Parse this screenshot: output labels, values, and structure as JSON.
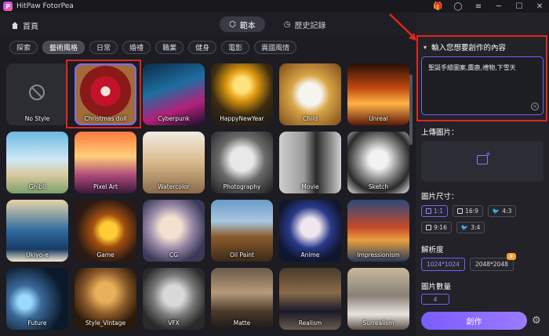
{
  "app": {
    "title": "HitPaw FotorPea"
  },
  "window_controls": [
    "minimize",
    "maximize",
    "close"
  ],
  "header": {
    "home_label": "首頁",
    "tabs": [
      {
        "label": "範本",
        "icon": "cube-icon",
        "active": true
      },
      {
        "label": "歷史記錄",
        "icon": "history-icon",
        "active": false
      }
    ]
  },
  "style_chips": [
    {
      "label": "探索",
      "active": false
    },
    {
      "label": "藝術風格",
      "active": true
    },
    {
      "label": "日常",
      "active": false
    },
    {
      "label": "婚禮",
      "active": false
    },
    {
      "label": "職業",
      "active": false
    },
    {
      "label": "健身",
      "active": false
    },
    {
      "label": "電影",
      "active": false
    },
    {
      "label": "異國風情",
      "active": false
    }
  ],
  "styles": [
    {
      "label": "No Style",
      "bg": "#2c2c33"
    },
    {
      "label": "Christmas doll",
      "bg": "radial-gradient(circle at 50% 45%, #f3e4d6 0 10%, #c4122b 11% 32%, #8a1a1a 33% 55%, #a26b3a 56%)"
    },
    {
      "label": "Cyberpunk",
      "bg": "linear-gradient(160deg,#0b2a4a,#1e6ea0 40%,#b3207a 70%,#1a0f2a)"
    },
    {
      "label": "HappyNewYear",
      "bg": "radial-gradient(circle at 50% 35%, #ffe27a 0 15%, #e09a10 30%, #3a2a10 60%, #1a1a1a)"
    },
    {
      "label": "Child",
      "bg": "radial-gradient(circle at 50% 50%, #f5f5f0 0 25%, #d8a445 45%, #7a4a1a)"
    },
    {
      "label": "Unreal",
      "bg": "linear-gradient(180deg,#2a0e06,#c14a10 40%,#ffb347 65%,#5a1a08)"
    },
    {
      "label": "Ghibli",
      "bg": "linear-gradient(180deg,#6cb9e2,#cfe8f5 45%,#d9c9a0 70%,#7aa06a)"
    },
    {
      "label": "Pixel Art",
      "bg": "linear-gradient(180deg,#ff7a3c,#ffd07a 40%,#b04a7a 70%,#3a1a3a)"
    },
    {
      "label": "Watercolor",
      "bg": "linear-gradient(180deg,#f1ece4,#d9b98a 50%,#8a6a4a)"
    },
    {
      "label": "Photography",
      "bg": "radial-gradient(circle at 50% 45%, #e8e8e8 0 25%, #6a6a6a 50%, #1a1a1a)"
    },
    {
      "label": "Movie",
      "bg": "linear-gradient(90deg,#cfcfcf,#9a9a9a 40%,#2a2a2a 60%,#d0d0d0)"
    },
    {
      "label": "Sketch",
      "bg": "radial-gradient(circle at 50% 45%, #f2f2f2 0 20%, #8a8a8a 45%, #2a2a2a 70%, #eaeaea)"
    },
    {
      "label": "Ukiyo-e",
      "bg": "linear-gradient(180deg,#e7d4a8,#2f6a9e 50%,#163a64 80%,#f3e9cf)"
    },
    {
      "label": "Game",
      "bg": "radial-gradient(circle at 55% 50%, #ffcc33 0 18%, #a4500f 35%, #2a1a14 70%)"
    },
    {
      "label": "CG",
      "bg": "radial-gradient(circle at 45% 45%, #f2e0d0 0 22%, #9a8aa8 45%, #3a3a58 75%)"
    },
    {
      "label": "Oil Paint",
      "bg": "linear-gradient(180deg,#6a9ac8,#a8c8e0 35%,#8a5a2a 60%,#3a2a1a)"
    },
    {
      "label": "Anime",
      "bg": "radial-gradient(circle at 50% 45%, #f0e6ef 0 20%, #2a3a8a 45%, #101530 75%)"
    },
    {
      "label": "Impressionism",
      "bg": "linear-gradient(180deg,#2a4a7a,#c84a2a 45%,#e8a040 65%,#2a3a5a)"
    },
    {
      "label": "Future",
      "bg": "radial-gradient(circle at 30% 55%, #9ad8ff 0 12%, #3a6a9a 30%, #0a1a2a 70%)"
    },
    {
      "label": "Style_Vintage",
      "bg": "radial-gradient(circle at 50% 40%, #e8b05a 0 20%, #8a5a2a 45%, #2a1a0a 75%)"
    },
    {
      "label": "VFX",
      "bg": "radial-gradient(circle at 50% 45%, #d8d8d8 0 22%, #7a7a7a 45%, #2a2a2a 75%)"
    },
    {
      "label": "Matte",
      "bg": "linear-gradient(180deg,#6a5a4a,#b89a7a 40%,#4a3a2a 70%,#1a1a1a)"
    },
    {
      "label": "Realism",
      "bg": "linear-gradient(180deg,#4a3a2a,#8a6a4a 40%,#1a1a2a 70%,#6a5a4a)"
    },
    {
      "label": "Surrealism",
      "bg": "linear-gradient(180deg,#c8b89a,#8a8078 45%,#e8e4dc 75%,#5a5048)"
    }
  ],
  "panel": {
    "prompt_title": "輸入您想要創作的內容",
    "prompt_text": "聖誕手繪圖案,麋鹿,禮物,下雪天",
    "upload_label": "上傳圖片：",
    "size_label": "圖片尺寸：",
    "ratios": [
      {
        "label": "1:1",
        "active": true
      },
      {
        "label": "16:9",
        "active": false
      },
      {
        "label": "4:3",
        "active": false
      },
      {
        "label": "9:16",
        "active": false
      },
      {
        "label": "3:4",
        "active": false
      }
    ],
    "resolution_label": "解析度",
    "resolutions": [
      {
        "label": "1024*1024",
        "active": true,
        "vip": false
      },
      {
        "label": "2048*2048",
        "active": false,
        "vip": true
      }
    ],
    "count_label": "圖片數量",
    "count_value": "4",
    "create_label": "創作"
  }
}
